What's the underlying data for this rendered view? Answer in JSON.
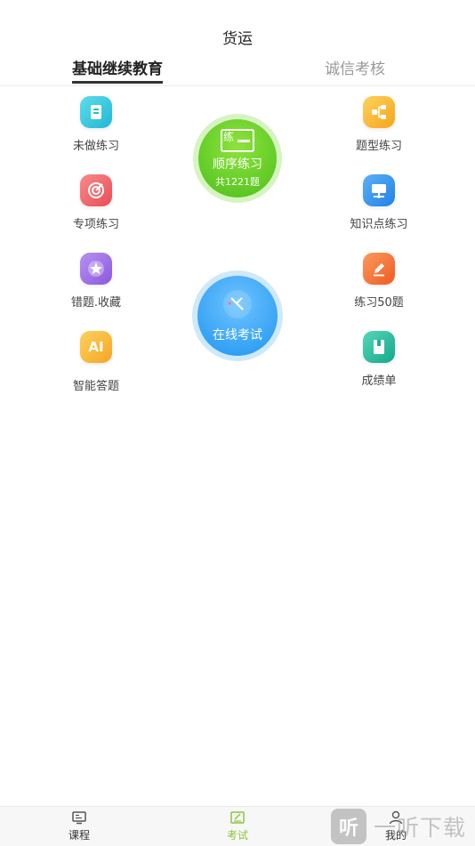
{
  "header": {
    "title": "货运"
  },
  "tabs": [
    {
      "label": "基础继续教育",
      "active": true
    },
    {
      "label": "诚信考核",
      "active": false
    }
  ],
  "features_left": [
    {
      "label": "未做练习",
      "icon": "notebook-icon",
      "color": "#2cc7dc"
    },
    {
      "label": "专项练习",
      "icon": "target-icon",
      "color": "#f06666"
    },
    {
      "label": "错题.收藏",
      "icon": "star-icon",
      "color": "#9b6be3"
    },
    {
      "label": "智能答题",
      "icon": "ai-icon",
      "color": "#f7b934"
    }
  ],
  "features_right": [
    {
      "label": "题型练习",
      "icon": "hierarchy-icon",
      "color": "#f8b72b"
    },
    {
      "label": "知识点练习",
      "icon": "monitor-icon",
      "color": "#2f8fea"
    },
    {
      "label": "练习50题",
      "icon": "pencil-icon",
      "color": "#f5723a"
    },
    {
      "label": "成绩单",
      "icon": "report-icon",
      "color": "#23b79a"
    }
  ],
  "sequential": {
    "icon_text": "练",
    "label": "顺序练习",
    "count": "共1221题",
    "color": "#5cc52a"
  },
  "exam": {
    "label": "在线考试",
    "color": "#2a9bf2"
  },
  "tabbar": [
    {
      "label": "课程",
      "icon": "course-icon",
      "active": false
    },
    {
      "label": "考试",
      "icon": "exam-icon",
      "active": true
    },
    {
      "label": "我的",
      "icon": "profile-icon",
      "active": false
    }
  ],
  "watermark": {
    "glyph": "听",
    "text": "一听下载"
  }
}
